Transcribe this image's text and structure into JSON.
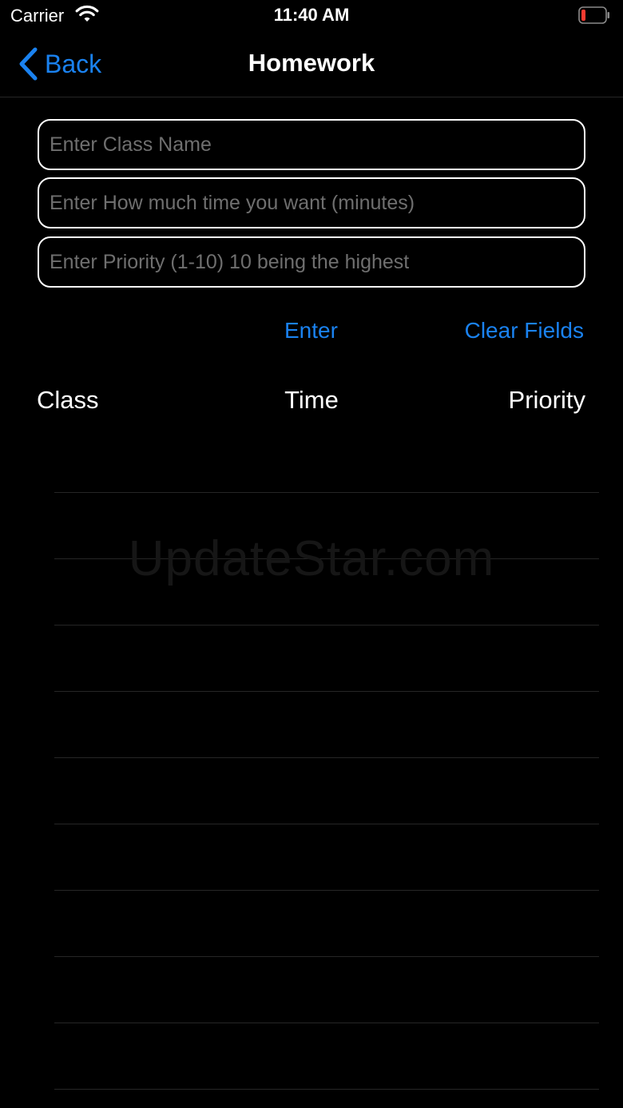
{
  "status_bar": {
    "carrier": "Carrier",
    "time": "11:40 AM",
    "wifi_icon": "wifi-icon",
    "battery_icon": "battery-low-icon",
    "battery_color": "#ff3b30"
  },
  "nav": {
    "back_label": "Back",
    "back_icon": "chevron-left-icon",
    "title": "Homework"
  },
  "form": {
    "class_placeholder": "Enter Class Name",
    "class_value": "",
    "time_placeholder": "Enter How much time you want (minutes)",
    "time_value": "",
    "priority_placeholder": "Enter Priority (1-10) 10 being the highest",
    "priority_value": ""
  },
  "actions": {
    "enter_label": "Enter",
    "clear_label": "Clear Fields"
  },
  "table": {
    "columns": [
      "Class",
      "Time",
      "Priority"
    ],
    "rows": []
  },
  "watermark": "UpdateStar.com",
  "colors": {
    "accent": "#1a82f0",
    "background": "#000000",
    "text": "#ffffff",
    "placeholder": "#6f6f6f",
    "separator": "#262626"
  }
}
